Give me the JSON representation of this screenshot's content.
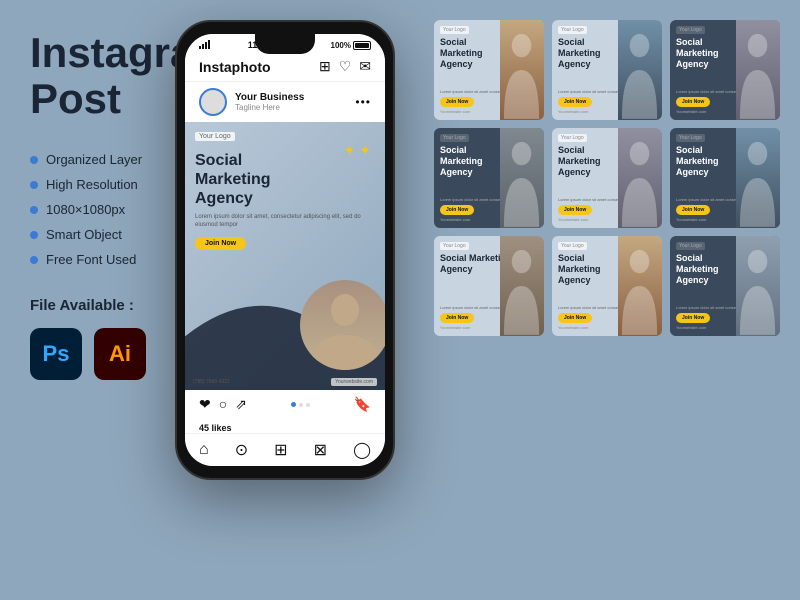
{
  "title": "Instagram Post",
  "left_panel": {
    "title_line1": "Instagram",
    "title_line2": "Post",
    "features": [
      "Organized Layer",
      "High Resolution",
      "1080×1080px",
      "Smart Object",
      "Free Font Used"
    ],
    "file_available_label": "File Available :",
    "ps_label": "Ps",
    "ai_label": "Ai"
  },
  "phone": {
    "status_time": "11: 11 a.m.",
    "status_battery": "100%",
    "app_name": "Instaphoto",
    "username": "Your Business",
    "tagline": "Tagline Here",
    "post": {
      "your_logo": "Your Logo",
      "title_line1": "Social",
      "title_line2": "Marketing",
      "title_line3": "Agency",
      "description": "Lorem ipsum dolor sit amet, consectetur adipiscing elit, sed do eiusmod tempor",
      "cta": "Join Now",
      "phone_number": "(785) 7890-4321",
      "website": "Yourwebsite.com"
    },
    "likes": "45 likes"
  },
  "templates": [
    {
      "id": "t1",
      "logo": "Your Logo",
      "title": "Social\nMarketing\nAgency",
      "dark": false,
      "photo_class": "photo-warm",
      "desc": "Lorem ipsum dolor sit amet consectetur",
      "btn": "Join Now",
      "website": "Yourwebsite.com"
    },
    {
      "id": "t2",
      "logo": "Your Logo",
      "title": "Social\nMarketing\nAgency",
      "dark": false,
      "photo_class": "photo-cool",
      "desc": "Lorem ipsum dolor sit amet consectetur",
      "btn": "Join Now",
      "website": "Yourwebsite.com"
    },
    {
      "id": "t3",
      "logo": "Your Logo",
      "title": "Social\nMarketing\nAgency",
      "dark": true,
      "photo_class": "photo-med",
      "desc": "Lorem ipsum dolor sit amet consectetur",
      "btn": "Join Now",
      "website": "Yourwebsite.com"
    },
    {
      "id": "t4",
      "logo": "Your Logo",
      "title": "Social\nMarketing\nAgency",
      "dark": true,
      "photo_class": "photo-business",
      "desc": "Lorem ipsum dolor sit amet consectetur",
      "btn": "Join Now",
      "website": "Yourwebsite.com"
    },
    {
      "id": "t5",
      "logo": "Your Logo",
      "title": "Social\nMarketing\nAgency",
      "dark": false,
      "photo_class": "photo-med",
      "desc": "Lorem ipsum dolor sit amet consectetur",
      "btn": "Join Now",
      "website": "Yourwebsite.com"
    },
    {
      "id": "t6",
      "logo": "Your Logo",
      "title": "Social\nMarketing\nAgency",
      "dark": true,
      "photo_class": "photo-cool",
      "desc": "Lorem ipsum dolor sit amet consectetur",
      "btn": "Join Now",
      "website": "Yourwebsite.com"
    },
    {
      "id": "t7",
      "logo": "Your Logo",
      "title": "Social Marketing\nAgency",
      "dark": false,
      "photo_class": "photo-desk",
      "desc": "Lorem ipsum dolor sit amet consectetur",
      "btn": "Join Now",
      "website": "Yourwebsite.com"
    },
    {
      "id": "t8",
      "logo": "Your Logo",
      "title": "Social\nMarketing\nAgency",
      "dark": false,
      "photo_class": "photo-warm",
      "desc": "Lorem ipsum dolor sit amet consectetur",
      "btn": "Join Now",
      "website": "Yourwebsite.com"
    },
    {
      "id": "t9",
      "logo": "Your Logo",
      "title": "Social\nMarketing\nAgency",
      "dark": true,
      "photo_class": "photo-suit",
      "desc": "Lorem ipsum dolor sit amet consectetur",
      "btn": "Join Now",
      "website": "Yourwebsite.com"
    }
  ],
  "colors": {
    "bg": "#8fa7bc",
    "accent": "#f5c518",
    "dark_text": "#1a2535",
    "blue_bullet": "#3a7bd5"
  }
}
